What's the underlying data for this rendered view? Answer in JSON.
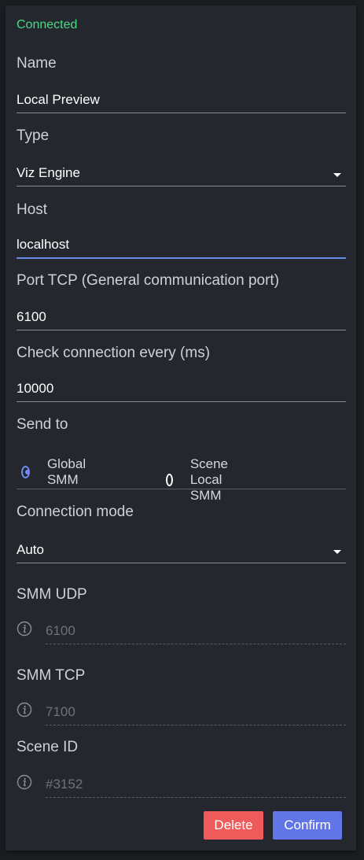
{
  "status": "Connected",
  "name": {
    "label": "Name",
    "value": "Local Preview"
  },
  "type": {
    "label": "Type",
    "value": "Viz Engine"
  },
  "host": {
    "label": "Host",
    "value": "localhost"
  },
  "port_tcp": {
    "label": "Port TCP (General communication port)",
    "value": "6100"
  },
  "check_connection": {
    "label": "Check connection every (ms)",
    "value": "10000"
  },
  "send_to": {
    "label": "Send to",
    "options": [
      {
        "label": "Global SMM",
        "selected": true
      },
      {
        "label": "Scene Local SMM",
        "selected": false
      }
    ]
  },
  "connection_mode": {
    "label": "Connection mode",
    "value": "Auto"
  },
  "smm_udp": {
    "label": "SMM UDP",
    "placeholder": "6100"
  },
  "smm_tcp": {
    "label": "SMM TCP",
    "placeholder": "7100"
  },
  "scene_id": {
    "label": "Scene ID",
    "placeholder": "#3152"
  },
  "actions": {
    "delete_label": "Delete",
    "confirm_label": "Confirm"
  },
  "colors": {
    "status_connected": "#4cd98a",
    "accent": "#6e8bf0",
    "delete": "#ef5a5a",
    "confirm": "#6275e6"
  }
}
